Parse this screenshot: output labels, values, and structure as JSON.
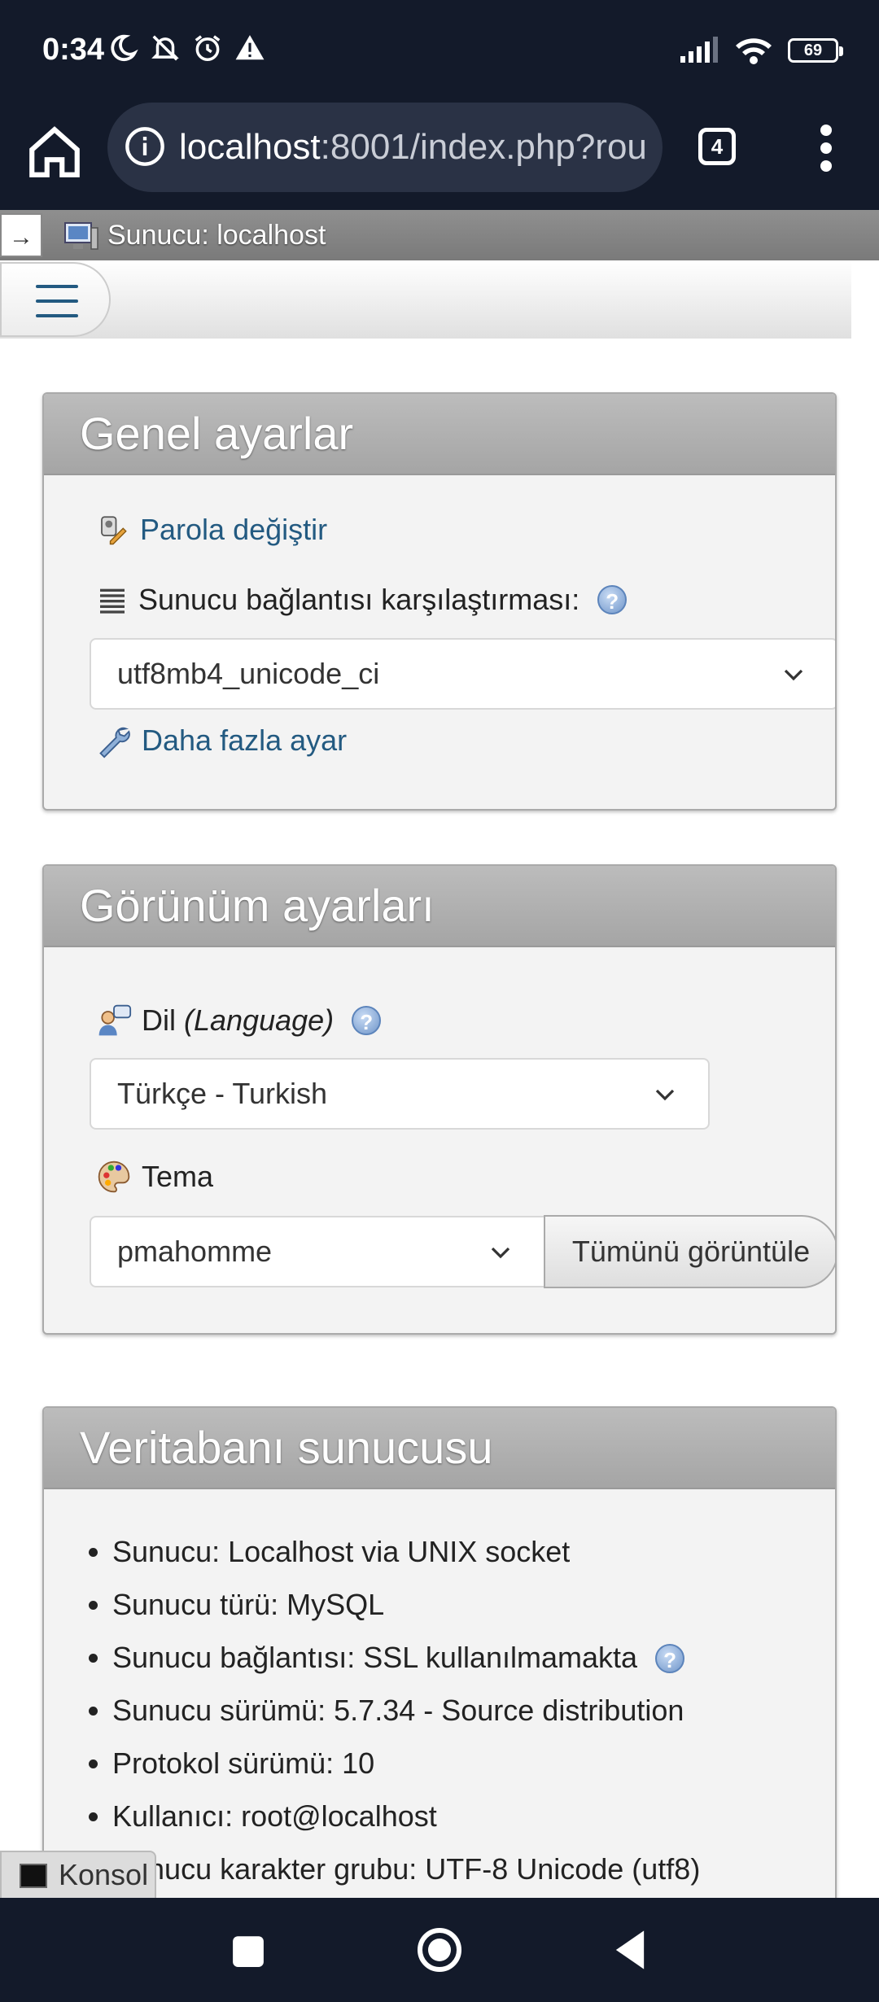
{
  "status_bar": {
    "time": "0:34",
    "battery": "69",
    "icons": [
      "moon-icon",
      "bell-off-icon",
      "alarm-icon",
      "warning-icon",
      "signal-icon",
      "wifi-icon",
      "battery-icon"
    ]
  },
  "browser": {
    "url_host": "localhost",
    "url_rest": ":8001/index.php?rou",
    "tab_count": "4"
  },
  "pma": {
    "server_strip": "Sunucu: localhost",
    "strip_arrow": "→"
  },
  "general": {
    "title": "Genel ayarlar",
    "change_password": "Parola değiştir",
    "collation_label": "Sunucu bağlantısı karşılaştırması:",
    "collation_value": "utf8mb4_unicode_ci",
    "more_settings": "Daha fazla ayar"
  },
  "appearance": {
    "title": "Görünüm ayarları",
    "language_label": "Dil",
    "language_label_en": "(Language)",
    "language_value": "Türkçe - Turkish",
    "theme_label": "Tema",
    "theme_value": "pmahomme",
    "view_all": "Tümünü görüntüle"
  },
  "db_server": {
    "title": "Veritabanı sunucusu",
    "items": [
      "Sunucu: Localhost via UNIX socket",
      "Sunucu türü: MySQL",
      "Sunucu bağlantısı: SSL kullanılmamakta",
      "Sunucu sürümü: 5.7.34 - Source distribution",
      "Protokol sürümü: 10",
      "Kullanıcı: root@localhost",
      "Sunucu karakter grubu: UTF-8 Unicode (utf8)"
    ]
  },
  "console": {
    "label": "Konsol"
  },
  "help_glyph": "?",
  "colors": {
    "system_bar": "#131a2a",
    "link": "#235a81",
    "panel_head": "#a5a5a5"
  }
}
